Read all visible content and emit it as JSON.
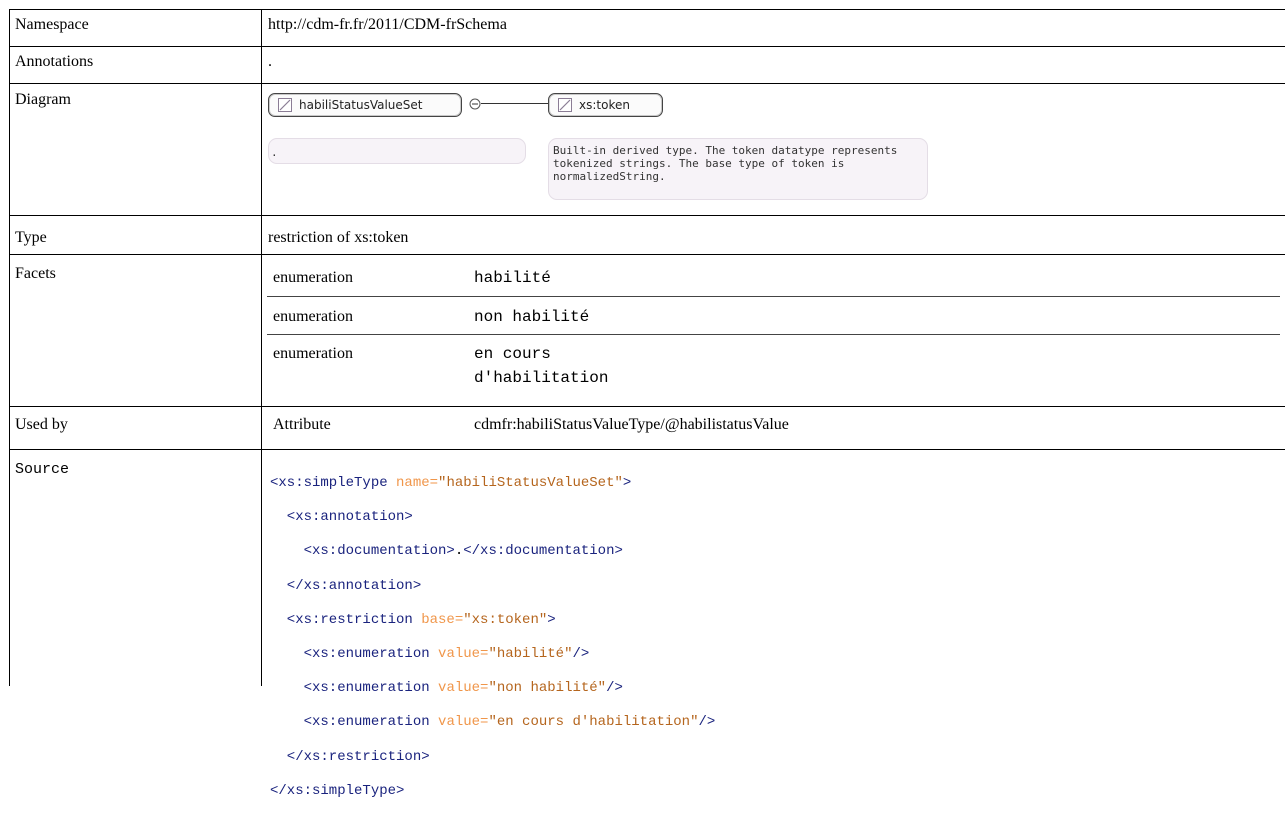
{
  "rows": {
    "namespace": {
      "label": "Namespace",
      "value": "http://cdm-fr.fr/2011/CDM-frSchema"
    },
    "annotations": {
      "label": "Annotations",
      "value": "."
    },
    "diagram": {
      "label": "Diagram"
    },
    "type": {
      "label": "Type",
      "value": "restriction of xs:token"
    },
    "facets": {
      "label": "Facets"
    },
    "used_by": {
      "label": "Used by"
    },
    "source": {
      "label": "Source"
    }
  },
  "diagram": {
    "main_node": "habiliStatusValueSet",
    "main_doc": ".",
    "base_node": "xs:token",
    "base_doc_lines": [
      "Built-in derived type. The token datatype represents",
      "tokenized strings. The base type of token is",
      "normalizedString."
    ]
  },
  "facets": [
    {
      "name": "enumeration",
      "value": "habilité"
    },
    {
      "name": "enumeration",
      "value": "non habilité"
    },
    {
      "name": "enumeration",
      "value_lines": [
        "en cours",
        "d'habilitation"
      ]
    }
  ],
  "used_by": {
    "kind": "Attribute",
    "ref": "cdmfr:habiliStatusValueType/@habilistatusValue"
  },
  "source": {
    "l1_open": "<xs:simpleType",
    "l1_attr": " name=",
    "l1_val": "\"habiliStatusValueSet\"",
    "l1_close": ">",
    "l2": "  <xs:annotation>",
    "l3_open": "    <xs:documentation>",
    "l3_text": ".",
    "l3_close": "</xs:documentation>",
    "l4": "  </xs:annotation>",
    "l5_open": "  <xs:restriction",
    "l5_attr": " base=",
    "l5_val": "\"xs:token\"",
    "l5_close": ">",
    "l6_open": "    <xs:enumeration",
    "l6_attr": " value=",
    "l6_val": "\"habilité\"",
    "l6_close": "/>",
    "l7_open": "    <xs:enumeration",
    "l7_attr": " value=",
    "l7_val": "\"non habilité\"",
    "l7_close": "/>",
    "l8_open": "    <xs:enumeration",
    "l8_attr": " value=",
    "l8_val": "\"en cours d'habilitation\"",
    "l8_close": "/>",
    "l9": "  </xs:restriction>",
    "l10": "</xs:simpleType>"
  }
}
